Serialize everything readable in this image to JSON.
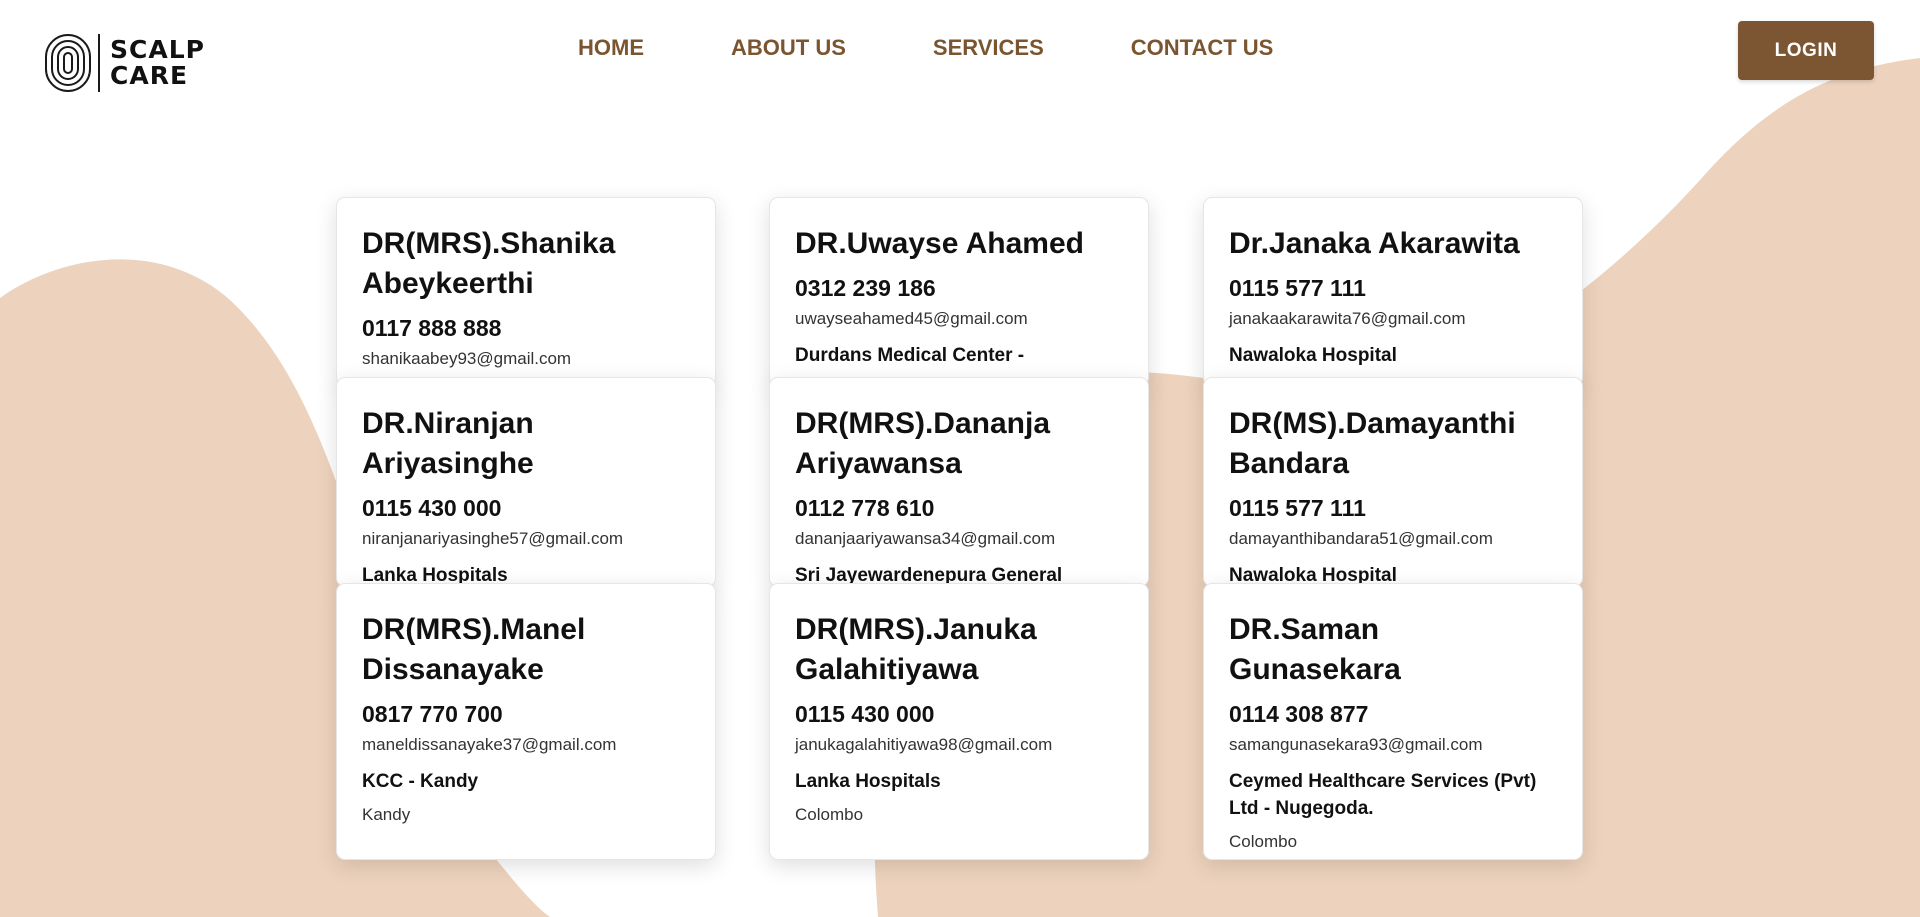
{
  "brand": {
    "line1": "SCALP",
    "line2": "CARE"
  },
  "nav": [
    {
      "label": "HOME"
    },
    {
      "label": "ABOUT US"
    },
    {
      "label": "SERVICES"
    },
    {
      "label": "CONTACT US"
    }
  ],
  "login_label": "LOGIN",
  "colors": {
    "brand_brown": "#7c5532",
    "nav_text": "#7a5530",
    "blob": "#edd3bd"
  },
  "doctors": [
    {
      "name": "DR(MRS).Shanika Abeykeerthi",
      "phone": "0117 888 888",
      "email": "shanikaabey93@gmail.com",
      "hospital": "",
      "city": ""
    },
    {
      "name": "DR.Uwayse Ahamed",
      "phone": "0312 239 186",
      "email": "uwayseahamed45@gmail.com",
      "hospital": "Durdans Medical Center -",
      "city": ""
    },
    {
      "name": "Dr.Janaka Akarawita",
      "phone": "0115 577 111",
      "email": "janakaakarawita76@gmail.com",
      "hospital": "Nawaloka Hospital",
      "city": ""
    },
    {
      "name": "DR.Niranjan Ariyasinghe",
      "phone": "0115 430 000",
      "email": "niranjanariyasinghe57@gmail.com",
      "hospital": "Lanka Hospitals",
      "city": ""
    },
    {
      "name": "DR(MRS).Dananja Ariyawansa",
      "phone": "0112 778 610",
      "email": "dananjaariyawansa34@gmail.com",
      "hospital": "Sri Jayewardenepura General",
      "city": ""
    },
    {
      "name": "DR(MS).Damayanthi Bandara",
      "phone": "0115 577 111",
      "email": "damayanthibandara51@gmail.com",
      "hospital": "Nawaloka Hospital",
      "city": ""
    },
    {
      "name": "DR(MRS).Manel Dissanayake",
      "phone": "0817 770 700",
      "email": "maneldissanayake37@gmail.com",
      "hospital": "KCC - Kandy",
      "city": "Kandy"
    },
    {
      "name": "DR(MRS).Januka Galahitiyawa",
      "phone": "0115 430 000",
      "email": "janukagalahitiyawa98@gmail.com",
      "hospital": "Lanka Hospitals",
      "city": "Colombo"
    },
    {
      "name": "DR.Saman Gunasekara",
      "phone": "0114 308 877",
      "email": "samangunasekara93@gmail.com",
      "hospital": "Ceymed Healthcare Services (Pvt) Ltd - Nugegoda.",
      "city": "Colombo"
    }
  ]
}
